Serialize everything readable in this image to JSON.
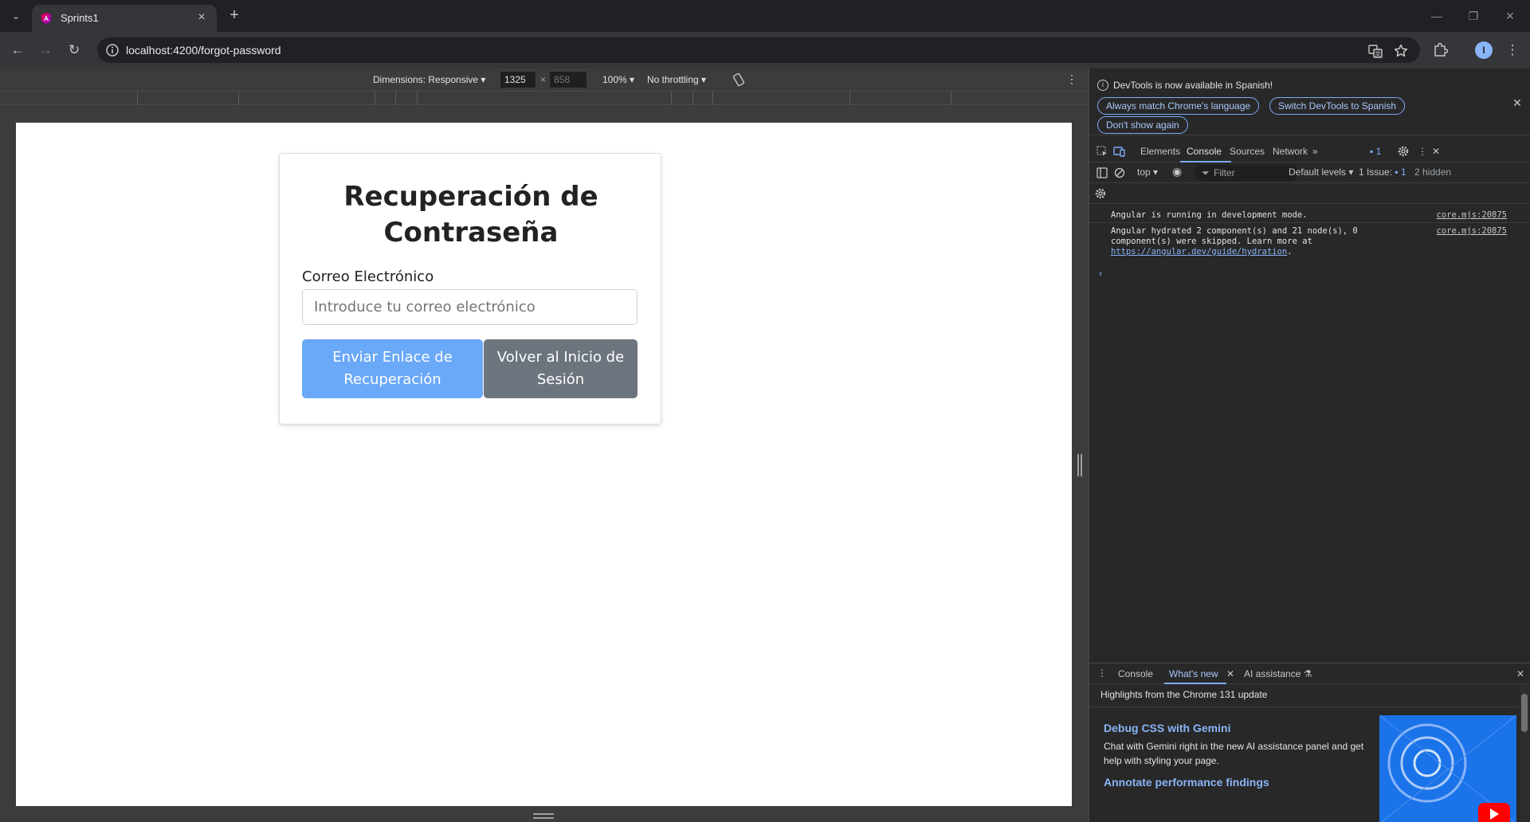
{
  "browser": {
    "tab_title": "Sprints1",
    "url": "localhost:4200/forgot-password"
  },
  "device_toolbar": {
    "dimensions_label": "Dimensions: Responsive",
    "width_value": "1325",
    "height_value": "858",
    "zoom": "100%",
    "throttling": "No throttling"
  },
  "page": {
    "title": "Recuperación de Contraseña",
    "email_label": "Correo Electrónico",
    "email_placeholder": "Introduce tu correo electrónico",
    "send_button": "Enviar Enlace de Recuperación",
    "back_button": "Volver al Inicio de Sesión"
  },
  "devtools": {
    "infobar": {
      "message": "DevTools is now available in Spanish!",
      "match_language": "Always match Chrome's language",
      "switch_spanish": "Switch DevTools to Spanish",
      "dont_show": "Don't show again"
    },
    "tabs": [
      "Elements",
      "Console",
      "Sources",
      "Network"
    ],
    "issues_badge": "1",
    "console_toolbar": {
      "context": "top",
      "filter_placeholder": "Filter",
      "levels": "Default levels",
      "issues_label": "1 Issue:",
      "issues_count": "1",
      "hidden": "2 hidden"
    },
    "messages": [
      {
        "text": "Angular is running in development mode.",
        "source": "core.mjs:20875"
      },
      {
        "text_line1": "Angular hydrated 2 component(s) and 21 node(s), 0",
        "text_line2": "component(s) were skipped. Learn more at",
        "link": "https://angular.dev/guide/hydration",
        "link_suffix": ".",
        "source": "core.mjs:20875"
      }
    ],
    "prompt": "›",
    "drawer": {
      "tabs": [
        "Console",
        "What's new",
        "AI assistance"
      ],
      "highlights": "Highlights from the Chrome 131 update",
      "items": [
        {
          "heading": "Debug CSS with Gemini",
          "body": "Chat with Gemini right in the new AI assistance panel and get help with styling your page."
        },
        {
          "heading": "Annotate performance findings"
        }
      ]
    }
  },
  "colors": {
    "primary_button": "#6aa8f8",
    "secondary_button": "#6c757d",
    "devtools_accent": "#7cacf8"
  }
}
